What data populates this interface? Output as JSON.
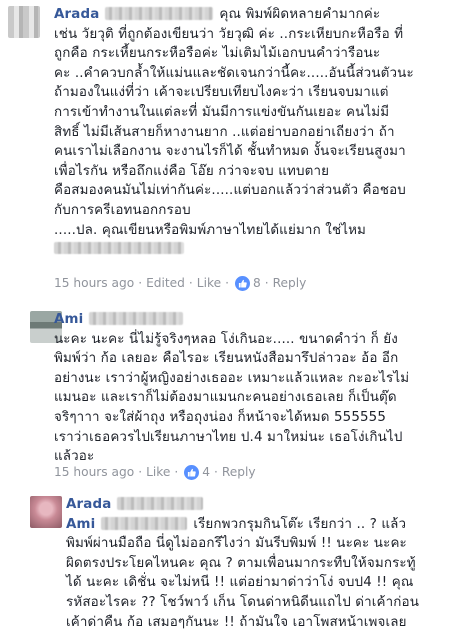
{
  "comments": [
    {
      "author": "Arada",
      "lines": [
        "คุณ พิมพ์ผิดหลายคำมากค่ะ",
        "เช่น วัยวุติ ที่ถูกต้องเขียนว่า วัยวุฒิ ค่ะ ..กระเหียบกะหือรือ ที่",
        "ถูกคือ  กระเหี้ยนกระหือรือค่ะ ไม่เติมไม้เอกบนคำว่ารือนะ",
        "คะ ..คำควบกล้ำให้แม่นและชัดเจนกว่านี้คะ.....อันนี้ส่วนตัวนะ",
        "ถ้ามองในแง่ที่ว่า   เค้าจะเปรียบเทียบไงคะว่า เรียนจบมาแต่",
        "การเข้าทำงานในแต่ละที่ มันมีการแข่งขันกันเยอะ  คนไม่มี",
        "สิทธิ์ ไม่มีเส้นสายก็หางานยาก ..แต่อย่าบอกอย่าเถียงว่า ถ้า",
        "คนเราไม่เลือกงาน จะงานไรก็ได้ ชั้นทำหมด งั้นจะเรียนสูงมา",
        "เพื่อไรกัน  หรือถึกแง่คือ  โอ๊ย กว่าจะจบ  แทบตาย",
        "คือสมองคนมันไม่เท่ากันค่ะ.....แต่บอกแล้วว่าส่วนตัว คือชอบ",
        "กับการครีเอทนอกกรอบ",
        ".....ปล. คุณเขียนหรือพิมพ์ภาษาไทยได้แย่มาก ใช่ไหม"
      ],
      "time": "15 hours ago",
      "edited": "Edited",
      "like": "Like",
      "reactions": "8",
      "reply": "Reply"
    },
    {
      "author": "Ami",
      "lines": [
        "นะคะ นะคะ นี่ไม่รู้จริงๆหลอ โง่เกินอะ..... ขนาดคำว่า ก็ ยัง",
        "พิมพ์ว่า ก้อ เลยอะ คือไรอะ เรียนหนังสือมารึปล่าวอะ อ้อ อีก",
        "อย่างนะ เราว่าผู้หญิงอย่างเธออะ เหมาะแล้วแหละ กะอะไรไม่",
        "แมนอะ และเราก็ไม่ต้องมาแมนกะคนอย่างเธอเลย ก็เป็นตุ๊ด",
        "จริๆาาา จะใส่ผ้าถุง หรือถุงน่อง ก็หน้าจะได้หมด 555555",
        "เราว่าเธอควรไปเรียนภาษาไทย ป.4 มาใหม่นะ เธอโง่เกินไป",
        "แล้วอะ"
      ],
      "time": "15 hours ago",
      "like": "Like",
      "reactions": "4",
      "reply": "Reply"
    },
    {
      "author": "Arada",
      "lines": [
        "Ami",
        "เรียกพวกรุมกินโต๊ะ เรียกว่า .. ? แล้ว",
        "พิมพ์ผ่านมือถือ นี่ดูไม่ออกรึไงว่า มันรีบพิมพ์ !! นะคะ นะคะ",
        "ผิดตรงประโยคไหนคะ คุณ ? ตามเพื่อนมากระทืบให้จมกระทู้",
        "ได้ นะคะ เดิชั่น จะไม่หนี !!  แต่อย่ามาด่าว่าโง่ จบป4  !! คุณ",
        "รหัสอะไรคะ ?? โชว์พาว์ เก็น โดนด่าหนิดีนแถไป ด่าเค้าก่อน",
        "เค้าด่าคืน ก้อ เสมอๆกันนะ !! ถ้ามันใจ เอาโพสหน้าเพจเลย"
      ]
    }
  ]
}
